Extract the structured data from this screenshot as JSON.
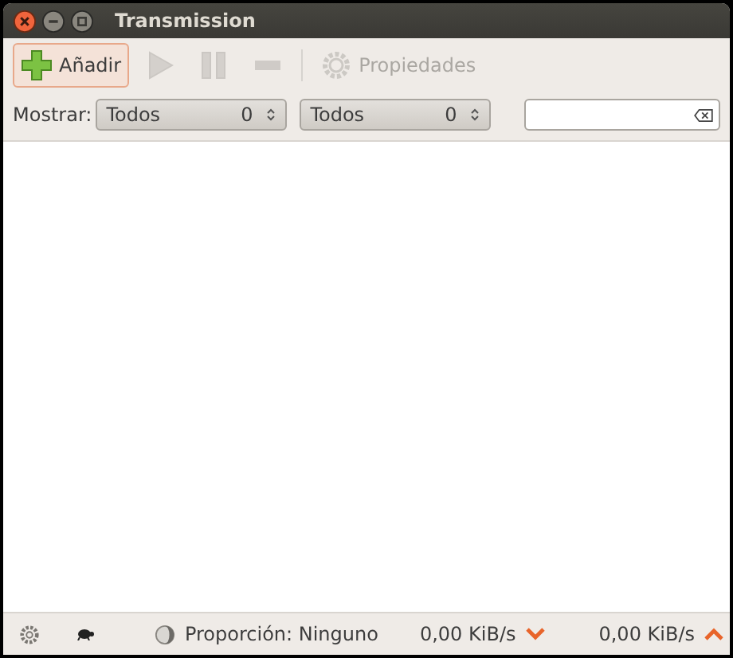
{
  "window": {
    "title": "Transmission"
  },
  "toolbar": [
    {
      "kind": "add",
      "label": "Añadir",
      "disabled": false,
      "highlighted": true
    },
    {
      "kind": "start",
      "disabled": true,
      "highlighted": false
    },
    {
      "kind": "pause",
      "disabled": true,
      "highlighted": false
    },
    {
      "kind": "remove",
      "disabled": true,
      "highlighted": false
    },
    {
      "kind": "properties",
      "label": "Propiedades",
      "disabled": true,
      "highlighted": false
    }
  ],
  "filter_bar": {
    "label": "Mostrar:",
    "filters": [
      {
        "value": "Todos",
        "count": "0"
      },
      {
        "value": "Todos",
        "count": "0"
      }
    ]
  },
  "status_bar": {
    "ratio": "Proporción: Ninguno",
    "download_speed": "0,00 KiB/s",
    "upload_speed": "0,00 KiB/s"
  }
}
